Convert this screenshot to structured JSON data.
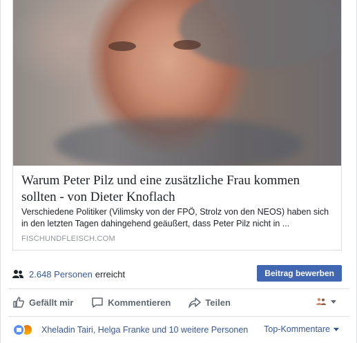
{
  "link_preview": {
    "title": "Warum Peter Pilz und eine zusätzliche Frau kommen sollten - von Dieter Knoflach",
    "description": "Verschiedene Politiker (Vilimsky von der FPÖ, Strolz von den NEOS) haben sich in den letzten Tagen dahingehend geäußert, dass Peter Pilz nicht in ...",
    "domain": "FISCHUNDFLEISCH.COM",
    "image_icon": "portrait-photo"
  },
  "reach": {
    "icon": "people-icon",
    "count": "2.648 Personen",
    "text": "erreicht",
    "boost_label": "Beitrag bewerben"
  },
  "actions": {
    "like_label": "Gefällt mir",
    "comment_label": "Kommentieren",
    "share_label": "Teilen",
    "audience_icon": "friends-icon"
  },
  "reactions": {
    "names": "Xheladin Tairi, Helga Franke und 10 weitere Personen",
    "sort_label": "Top-Kommentare",
    "icons": [
      "like-reaction-icon",
      "angry-reaction-icon"
    ]
  },
  "colors": {
    "link": "#365899",
    "button": "#4267b2",
    "muted": "#606770"
  }
}
